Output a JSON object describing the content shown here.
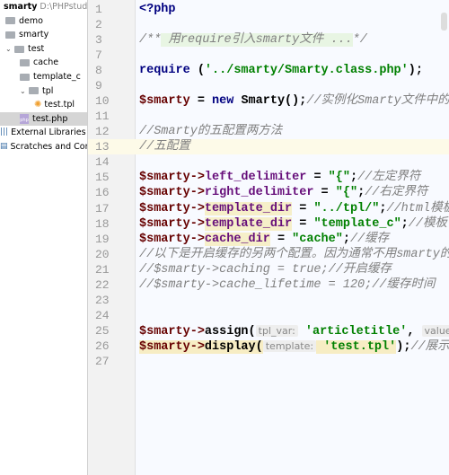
{
  "sidebar": {
    "project": {
      "name": "smarty",
      "path": "D:\\PHPstudy\\"
    },
    "items": [
      {
        "label": "demo",
        "type": "folder",
        "depth": 1
      },
      {
        "label": "smarty",
        "type": "folder",
        "depth": 1
      },
      {
        "label": "test",
        "type": "folder",
        "depth": 1,
        "expanded": true
      },
      {
        "label": "cache",
        "type": "folder",
        "depth": 2
      },
      {
        "label": "template_c",
        "type": "folder",
        "depth": 2
      },
      {
        "label": "tpl",
        "type": "folder",
        "depth": 2,
        "expanded": true
      },
      {
        "label": "test.tpl",
        "type": "tpl",
        "depth": 3
      },
      {
        "label": "test.php",
        "type": "php",
        "depth": 2,
        "selected": true
      },
      {
        "label": "External Libraries",
        "type": "lib",
        "depth": 0
      },
      {
        "label": "Scratches and Conso",
        "type": "scratch",
        "depth": 0
      }
    ]
  },
  "editor": {
    "current_line": "13",
    "lines": [
      {
        "n": "1",
        "tokens": [
          {
            "t": "<?php",
            "c": "kw"
          }
        ]
      },
      {
        "n": "2",
        "tokens": []
      },
      {
        "n": "3",
        "tokens": [
          {
            "t": "/**",
            "c": "doc"
          },
          {
            "t": " 用require引入smarty文件 ...",
            "c": "doc docbg"
          },
          {
            "t": "*/",
            "c": "doc"
          }
        ]
      },
      {
        "n": "7",
        "tokens": []
      },
      {
        "n": "8",
        "tokens": [
          {
            "t": "require",
            "c": "kw"
          },
          {
            "t": " (",
            "c": "plain"
          },
          {
            "t": "'../smarty/Smarty.class.php'",
            "c": "str"
          },
          {
            "t": ");",
            "c": "plain"
          }
        ]
      },
      {
        "n": "9",
        "tokens": []
      },
      {
        "n": "10",
        "tokens": [
          {
            "t": "$smarty",
            "c": "var"
          },
          {
            "t": " = ",
            "c": "plain"
          },
          {
            "t": "new",
            "c": "kw"
          },
          {
            "t": " Smarty();",
            "c": "plain"
          },
          {
            "t": "//实例化Smarty文件中的",
            "c": "cm"
          }
        ]
      },
      {
        "n": "11",
        "tokens": []
      },
      {
        "n": "12",
        "tokens": [
          {
            "t": "//Smarty的五配置两方法",
            "c": "cm"
          }
        ]
      },
      {
        "n": "13",
        "tokens": [
          {
            "t": "//五配置",
            "c": "cm"
          }
        ]
      },
      {
        "n": "14",
        "tokens": []
      },
      {
        "n": "15",
        "tokens": [
          {
            "t": "$smarty",
            "c": "var"
          },
          {
            "t": "->",
            "c": "var"
          },
          {
            "t": "left_delimiter",
            "c": "prop"
          },
          {
            "t": " = ",
            "c": "plain"
          },
          {
            "t": "\"{\"",
            "c": "str"
          },
          {
            "t": ";",
            "c": "plain"
          },
          {
            "t": "//左定界符",
            "c": "cm"
          }
        ]
      },
      {
        "n": "16",
        "tokens": [
          {
            "t": "$smarty",
            "c": "var"
          },
          {
            "t": "->",
            "c": "var"
          },
          {
            "t": "right_delimiter",
            "c": "prop"
          },
          {
            "t": " = ",
            "c": "plain"
          },
          {
            "t": "\"{\"",
            "c": "str"
          },
          {
            "t": ";",
            "c": "plain"
          },
          {
            "t": "//右定界符",
            "c": "cm"
          }
        ]
      },
      {
        "n": "17",
        "tokens": [
          {
            "t": "$smarty",
            "c": "var"
          },
          {
            "t": "->",
            "c": "var"
          },
          {
            "t": "template_dir",
            "c": "propb"
          },
          {
            "t": " = ",
            "c": "plain"
          },
          {
            "t": "\"../tpl/\"",
            "c": "str"
          },
          {
            "t": ";",
            "c": "plain"
          },
          {
            "t": "//html模板",
            "c": "cm"
          }
        ]
      },
      {
        "n": "18",
        "tokens": [
          {
            "t": "$smarty",
            "c": "var"
          },
          {
            "t": "->",
            "c": "var"
          },
          {
            "t": "template_dir",
            "c": "propb"
          },
          {
            "t": " = ",
            "c": "plain"
          },
          {
            "t": "\"template_c\"",
            "c": "str"
          },
          {
            "t": ";",
            "c": "plain"
          },
          {
            "t": "//模板",
            "c": "cm"
          }
        ]
      },
      {
        "n": "19",
        "tokens": [
          {
            "t": "$smarty",
            "c": "var"
          },
          {
            "t": "->",
            "c": "var"
          },
          {
            "t": "cache_dir",
            "c": "propb"
          },
          {
            "t": " = ",
            "c": "plain"
          },
          {
            "t": "\"cache\"",
            "c": "str"
          },
          {
            "t": ";",
            "c": "plain"
          },
          {
            "t": "//缓存",
            "c": "cm"
          }
        ]
      },
      {
        "n": "20",
        "tokens": [
          {
            "t": "//以下是开启缓存的另两个配置。因为通常不用smarty的",
            "c": "cm"
          }
        ]
      },
      {
        "n": "21",
        "tokens": [
          {
            "t": "//$smarty->caching = true;//开启缓存",
            "c": "cm"
          }
        ]
      },
      {
        "n": "22",
        "tokens": [
          {
            "t": "//$smarty->cache_lifetime = 120;//缓存时间",
            "c": "cm"
          }
        ]
      },
      {
        "n": "23",
        "tokens": []
      },
      {
        "n": "24",
        "tokens": []
      },
      {
        "n": "25",
        "tokens": [
          {
            "t": "$smarty",
            "c": "var"
          },
          {
            "t": "->",
            "c": "var"
          },
          {
            "t": "assign(",
            "c": "plain"
          },
          {
            "t": "tpl_var:",
            "c": "ph"
          },
          {
            "t": " 'articletitle'",
            "c": "str"
          },
          {
            "t": ", ",
            "c": "plain"
          },
          {
            "t": "value:",
            "c": "ph"
          }
        ]
      },
      {
        "n": "26",
        "tokens": [
          {
            "t": "$smarty",
            "c": "var hl"
          },
          {
            "t": "->",
            "c": "var hl"
          },
          {
            "t": "display(",
            "c": "plain hl"
          },
          {
            "t": "template:",
            "c": "ph"
          },
          {
            "t": " 'test.tpl'",
            "c": "str hl"
          },
          {
            "t": ");",
            "c": "plain"
          },
          {
            "t": "//展示",
            "c": "cm"
          }
        ]
      },
      {
        "n": "27",
        "tokens": []
      }
    ]
  }
}
